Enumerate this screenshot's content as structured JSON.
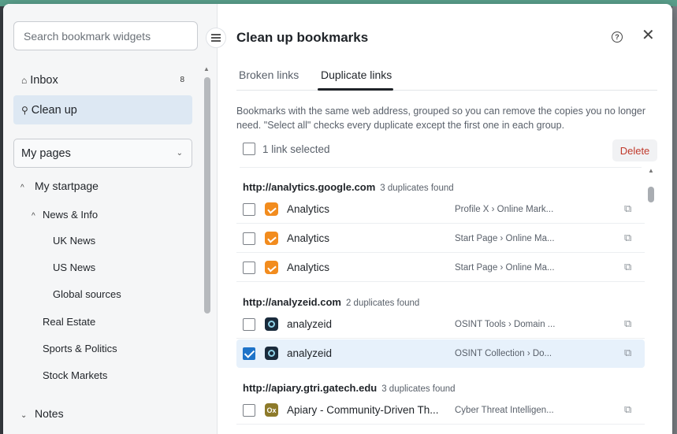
{
  "sidebar": {
    "search_placeholder": "Search bookmark widgets",
    "inbox": {
      "label": "Inbox",
      "count": "8"
    },
    "cleanup": {
      "label": "Clean up"
    },
    "pages_select": "My pages",
    "tree": {
      "my_startpage": "My startpage",
      "news_info": "News & Info",
      "uk_news": "UK News",
      "us_news": "US News",
      "global_sources": "Global sources",
      "real_estate": "Real Estate",
      "sports_politics": "Sports & Politics",
      "stock_markets": "Stock Markets",
      "notes": "Notes"
    }
  },
  "main": {
    "title": "Clean up bookmarks",
    "tabs": [
      "Broken links",
      "Duplicate links"
    ],
    "description": "Bookmarks with the same web address, grouped so you can remove the copies you no longer need. \"Select all\" checks every duplicate except the first one in each group.",
    "selected_label": "1 link selected",
    "delete_label": "Delete",
    "groups": [
      {
        "url": "http://analytics.google.com",
        "dup": "3 duplicates found",
        "rows": [
          {
            "name": "Analytics",
            "path": "Profile X › Online Mark...",
            "checked": false
          },
          {
            "name": "Analytics",
            "path": "Start Page › Online Ma...",
            "checked": false
          },
          {
            "name": "Analytics",
            "path": "Start Page › Online Ma...",
            "checked": false
          }
        ]
      },
      {
        "url": "http://analyzeid.com",
        "dup": "2 duplicates found",
        "rows": [
          {
            "name": "analyzeid",
            "path": "OSINT Tools › Domain ...",
            "checked": false
          },
          {
            "name": "analyzeid",
            "path": "OSINT Collection › Do...",
            "checked": true
          }
        ]
      },
      {
        "url": "http://apiary.gtri.gatech.edu",
        "dup": "3 duplicates found",
        "rows": [
          {
            "name": "Apiary - Community-Driven Th...",
            "path": "Cyber Threat Intelligen...",
            "checked": false
          }
        ]
      }
    ]
  },
  "icons": {
    "help": "?",
    "close": "✕",
    "external": "⧉",
    "favicon_apiary": "Ox"
  }
}
